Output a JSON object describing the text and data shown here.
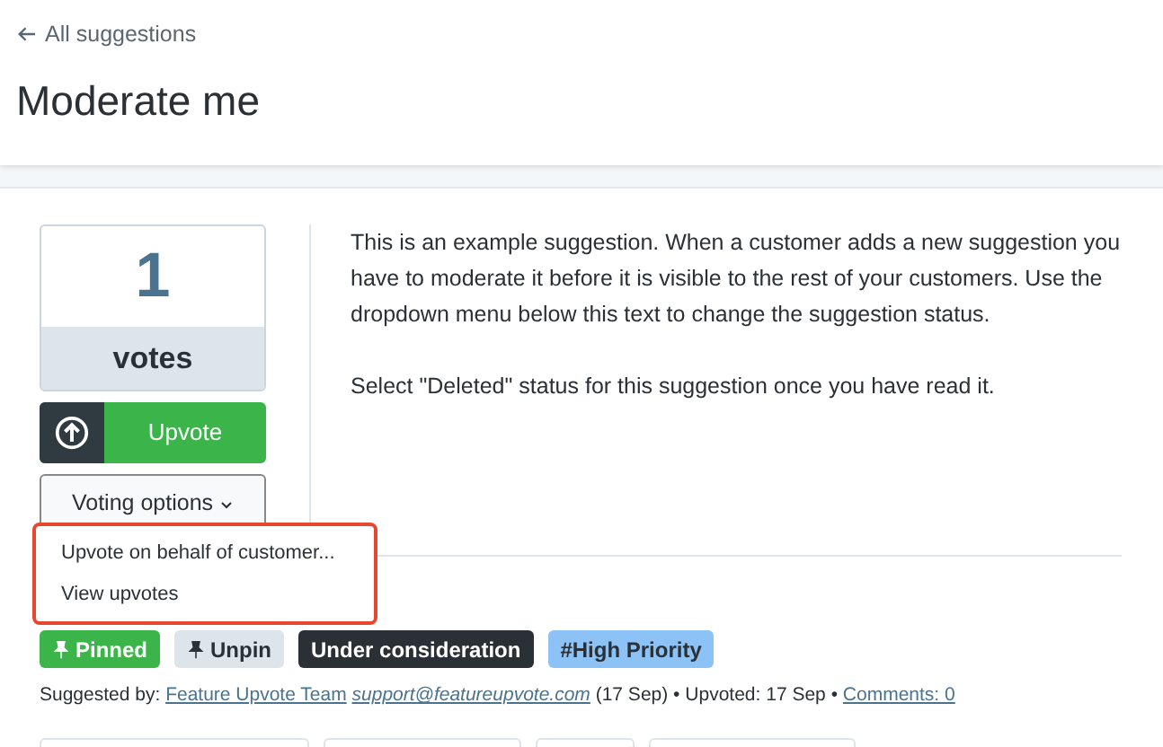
{
  "back_link": {
    "label": "All suggestions"
  },
  "title": "Moderate me",
  "votes": {
    "count": "1",
    "label": "votes"
  },
  "upvote_button": {
    "label": "Upvote"
  },
  "voting_options": {
    "label": "Voting options",
    "expanded": true,
    "menu": [
      {
        "label": "Upvote on behalf of customer..."
      },
      {
        "label": "View upvotes"
      }
    ]
  },
  "description": [
    "This is an example suggestion. When a customer adds a new suggestion you have to moderate it before it is visible to the rest of your customers. Use the dropdown menu below this text to change the suggestion status.",
    "Select \"Deleted\" status for this suggestion once you have read it."
  ],
  "badges": [
    {
      "label": "Pinned",
      "kind": "pinned",
      "color": "#3bb54a"
    },
    {
      "label": "Unpin",
      "kind": "unpin",
      "color": "#dde4ea"
    },
    {
      "label": "Under consideration",
      "kind": "status",
      "color": "#2a3035"
    },
    {
      "label": "#High Priority",
      "kind": "tag",
      "color": "#8cc2f5"
    }
  ],
  "meta": {
    "prefix": "Suggested by:",
    "author": "Feature Upvote Team",
    "email": "support@featureupvote.com",
    "date": "(17 Sep)",
    "separator_1": "•",
    "upvoted": "Upvoted: 17 Sep",
    "separator_2": "•",
    "comments": "Comments: 0"
  }
}
